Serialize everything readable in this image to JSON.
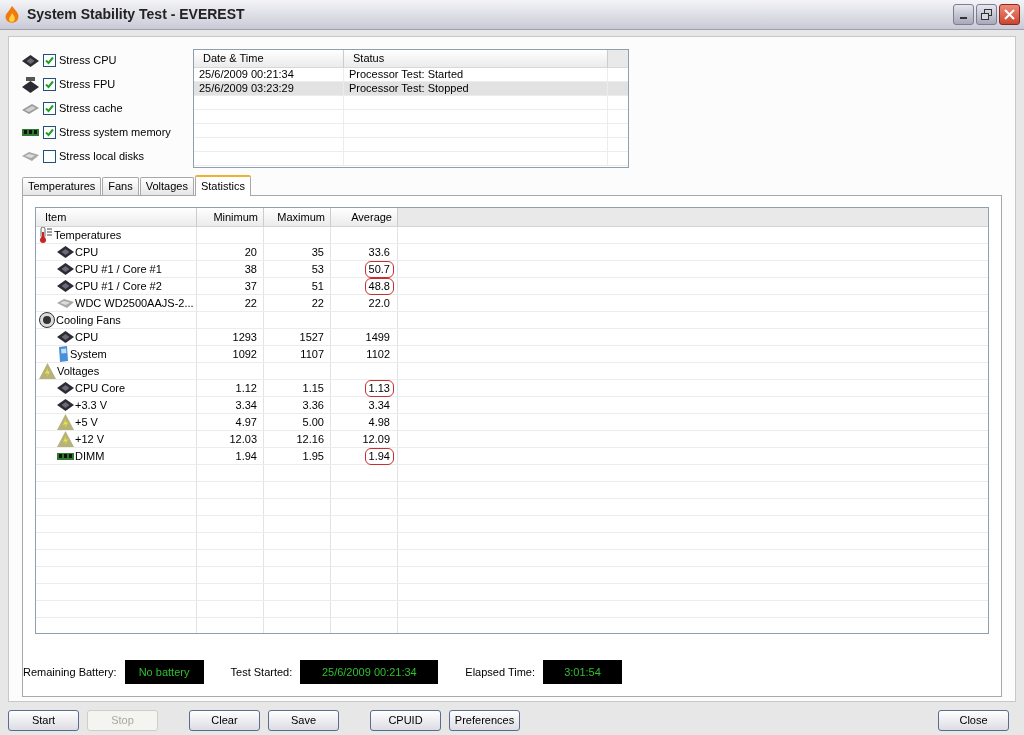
{
  "window": {
    "title": "System Stability Test - EVEREST"
  },
  "stress_options": [
    {
      "label": "Stress CPU",
      "kind": "cpu",
      "checked": true
    },
    {
      "label": "Stress FPU",
      "kind": "fpu",
      "checked": true
    },
    {
      "label": "Stress cache",
      "kind": "cache",
      "checked": true
    },
    {
      "label": "Stress system memory",
      "kind": "memory",
      "checked": true
    },
    {
      "label": "Stress local disks",
      "kind": "disk",
      "checked": false
    }
  ],
  "event_log": {
    "columns": [
      "Date & Time",
      "Status"
    ],
    "rows": [
      {
        "date": "25/6/2009 00:21:34",
        "status": "Processor Test: Started",
        "selected": false
      },
      {
        "date": "25/6/2009 03:23:29",
        "status": "Processor Test: Stopped",
        "selected": true
      }
    ]
  },
  "tabs": [
    {
      "label": "Temperatures",
      "selected": false
    },
    {
      "label": "Fans",
      "selected": false
    },
    {
      "label": "Voltages",
      "selected": false
    },
    {
      "label": "Statistics",
      "selected": true
    }
  ],
  "statistics": {
    "columns": [
      "Item",
      "Minimum",
      "Maximum",
      "Average"
    ],
    "groups": [
      {
        "label": "Temperatures",
        "kind": "thermometer",
        "children": [
          {
            "label": "CPU",
            "kind": "cpu",
            "min": "20",
            "max": "35",
            "avg": "33.6",
            "circled": false
          },
          {
            "label": "CPU #1 / Core #1",
            "kind": "cpu",
            "min": "38",
            "max": "53",
            "avg": "50.7",
            "circled": true
          },
          {
            "label": "CPU #1 / Core #2",
            "kind": "cpu",
            "min": "37",
            "max": "51",
            "avg": "48.8",
            "circled": true
          },
          {
            "label": "WDC WD2500AAJS-2...",
            "kind": "disk",
            "min": "22",
            "max": "22",
            "avg": "22.0",
            "circled": false
          }
        ]
      },
      {
        "label": "Cooling Fans",
        "kind": "fan",
        "children": [
          {
            "label": "CPU",
            "kind": "cpu",
            "min": "1293",
            "max": "1527",
            "avg": "1499",
            "circled": false
          },
          {
            "label": "System",
            "kind": "system",
            "min": "1092",
            "max": "1107",
            "avg": "1102",
            "circled": false
          }
        ]
      },
      {
        "label": "Voltages",
        "kind": "voltage",
        "children": [
          {
            "label": "CPU Core",
            "kind": "cpu",
            "min": "1.12",
            "max": "1.15",
            "avg": "1.13",
            "circled": true
          },
          {
            "label": "+3.3 V",
            "kind": "cpu",
            "min": "3.34",
            "max": "3.36",
            "avg": "3.34",
            "circled": false
          },
          {
            "label": "+5 V",
            "kind": "voltage",
            "min": "4.97",
            "max": "5.00",
            "avg": "4.98",
            "circled": false
          },
          {
            "label": "+12 V",
            "kind": "voltage",
            "min": "12.03",
            "max": "12.16",
            "avg": "12.09",
            "circled": false
          },
          {
            "label": "DIMM",
            "kind": "memory",
            "min": "1.94",
            "max": "1.95",
            "avg": "1.94",
            "circled": true
          }
        ]
      }
    ]
  },
  "readouts": [
    {
      "label": "Remaining Battery:",
      "value": "No battery"
    },
    {
      "label": "Test Started:",
      "value": "25/6/2009 00:21:34"
    },
    {
      "label": "Elapsed Time:",
      "value": "3:01:54"
    }
  ],
  "buttons": [
    {
      "label": "Start",
      "disabled": false
    },
    {
      "label": "Stop",
      "disabled": true
    },
    {
      "label": "Clear",
      "disabled": false
    },
    {
      "label": "Save",
      "disabled": false
    },
    {
      "label": "CPUID",
      "disabled": false
    },
    {
      "label": "Preferences",
      "disabled": false
    },
    {
      "label": "Close",
      "disabled": false
    }
  ]
}
